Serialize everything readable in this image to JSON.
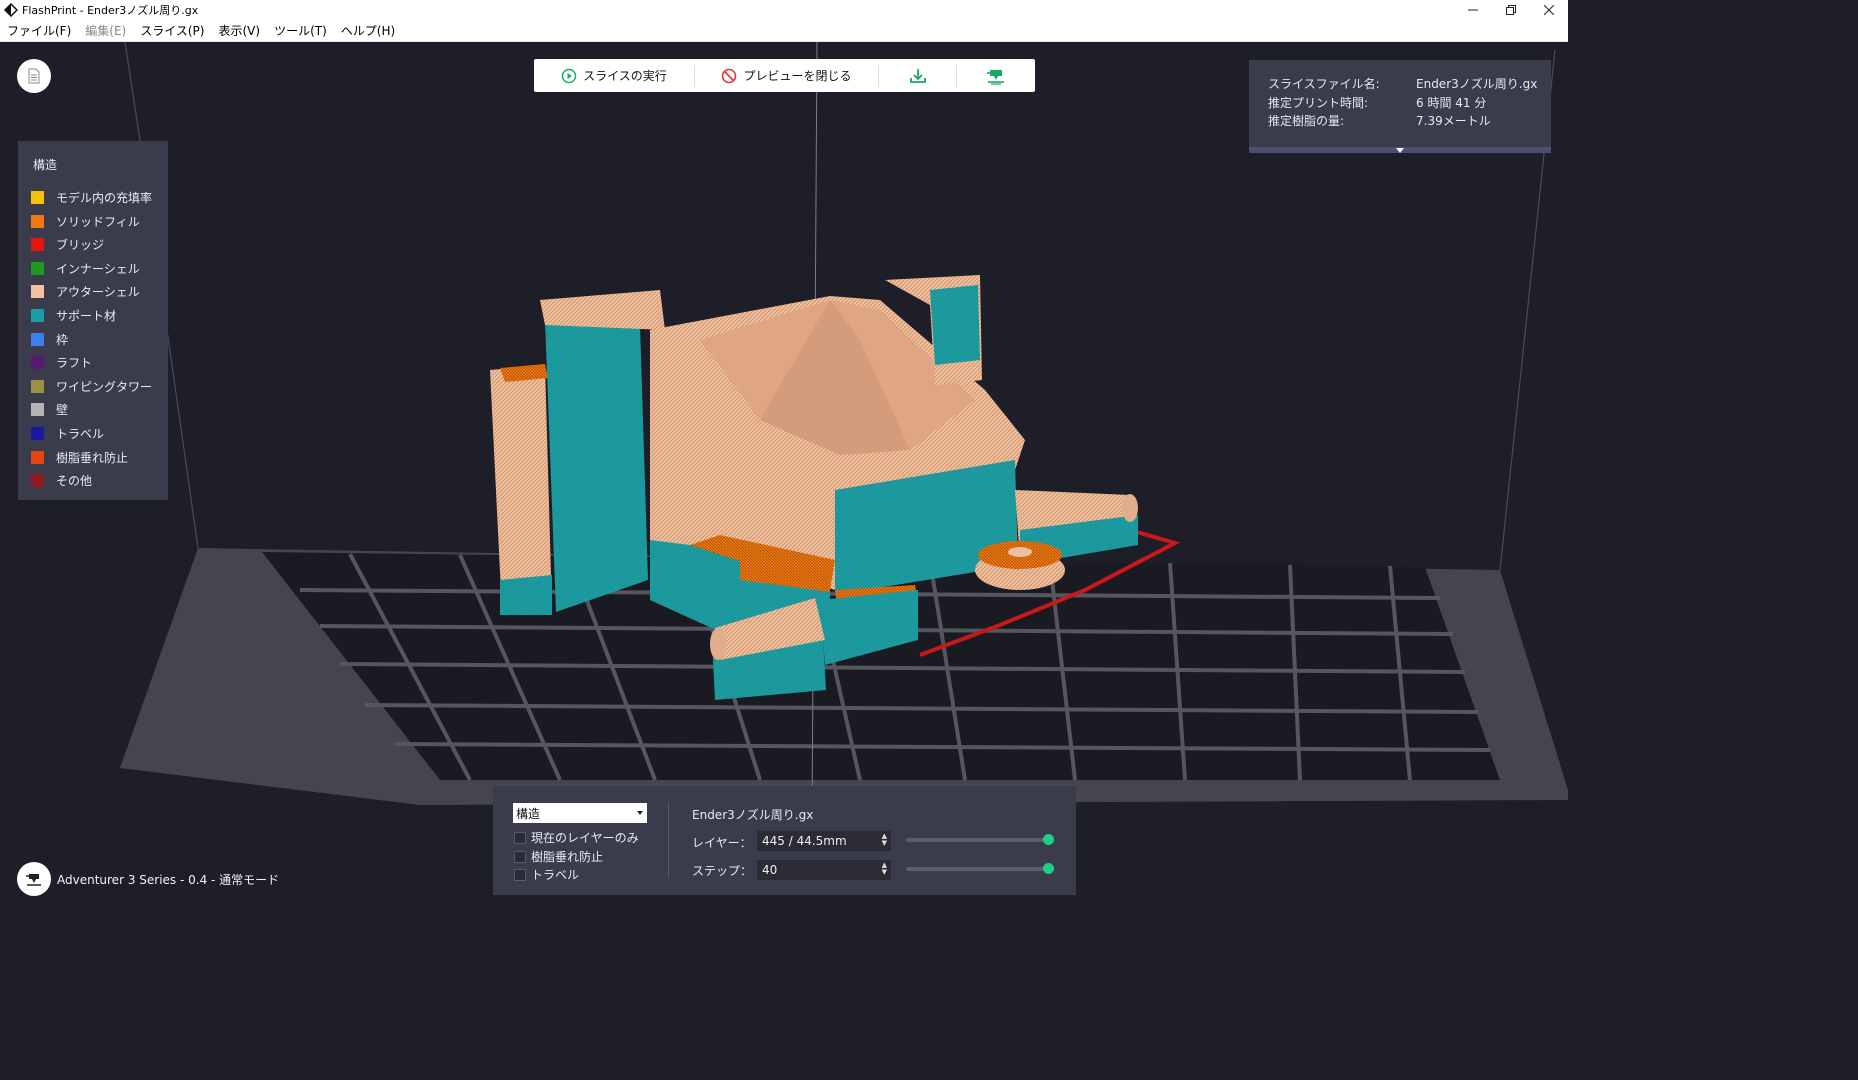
{
  "window": {
    "title": "FlashPrint - Ender3ノズル周り.gx"
  },
  "menu": [
    {
      "label": "ファイル(F)",
      "disabled": false
    },
    {
      "label": "編集(E)",
      "disabled": true
    },
    {
      "label": "スライス(P)",
      "disabled": false
    },
    {
      "label": "表示(V)",
      "disabled": false
    },
    {
      "label": "ツール(T)",
      "disabled": false
    },
    {
      "label": "ヘルプ(H)",
      "disabled": false
    }
  ],
  "toolbar": {
    "slice_label": "スライスの実行",
    "close_preview_label": "プレビューを閉じる"
  },
  "info": {
    "file_label": "スライスファイル名:",
    "file_value": "Ender3ノズル周り.gx",
    "time_label": "推定プリント時間:",
    "time_value": "6 時間 41 分",
    "resin_label": "推定樹脂の量:",
    "resin_value": "7.39メートル"
  },
  "legend": {
    "title": "構造",
    "items": [
      {
        "label": "モデル内の充填率",
        "color": "#f5c400"
      },
      {
        "label": "ソリッドフィル",
        "color": "#f07a0f"
      },
      {
        "label": "ブリッジ",
        "color": "#e61515"
      },
      {
        "label": "インナーシェル",
        "color": "#1d9a22"
      },
      {
        "label": "アウターシェル",
        "color": "#f4c2a0"
      },
      {
        "label": "サポート材",
        "color": "#1a9ea3"
      },
      {
        "label": "枠",
        "color": "#3d7ff0"
      },
      {
        "label": "ラフト",
        "color": "#5a1a70"
      },
      {
        "label": "ワイピングタワー",
        "color": "#9c9148"
      },
      {
        "label": "壁",
        "color": "#b3b3b3"
      },
      {
        "label": "トラベル",
        "color": "#1a1aa0"
      },
      {
        "label": "樹脂垂れ防止",
        "color": "#e8460f"
      },
      {
        "label": "その他",
        "color": "#8a1d1d"
      }
    ]
  },
  "controls": {
    "view_select": "構造",
    "checks": [
      {
        "label": "現在のレイヤーのみ",
        "checked": false
      },
      {
        "label": "樹脂垂れ防止",
        "checked": false
      },
      {
        "label": "トラベル",
        "checked": false
      }
    ],
    "file_name": "Ender3ノズル周り.gx",
    "layer_label": "レイヤー：",
    "layer_value": "445 / 44.5mm",
    "layer_fraction": 1.0,
    "step_label": "ステップ：",
    "step_value": "40",
    "step_fraction": 1.0
  },
  "machine": {
    "label": "Adventurer 3 Series - 0.4 - 通常モード"
  }
}
